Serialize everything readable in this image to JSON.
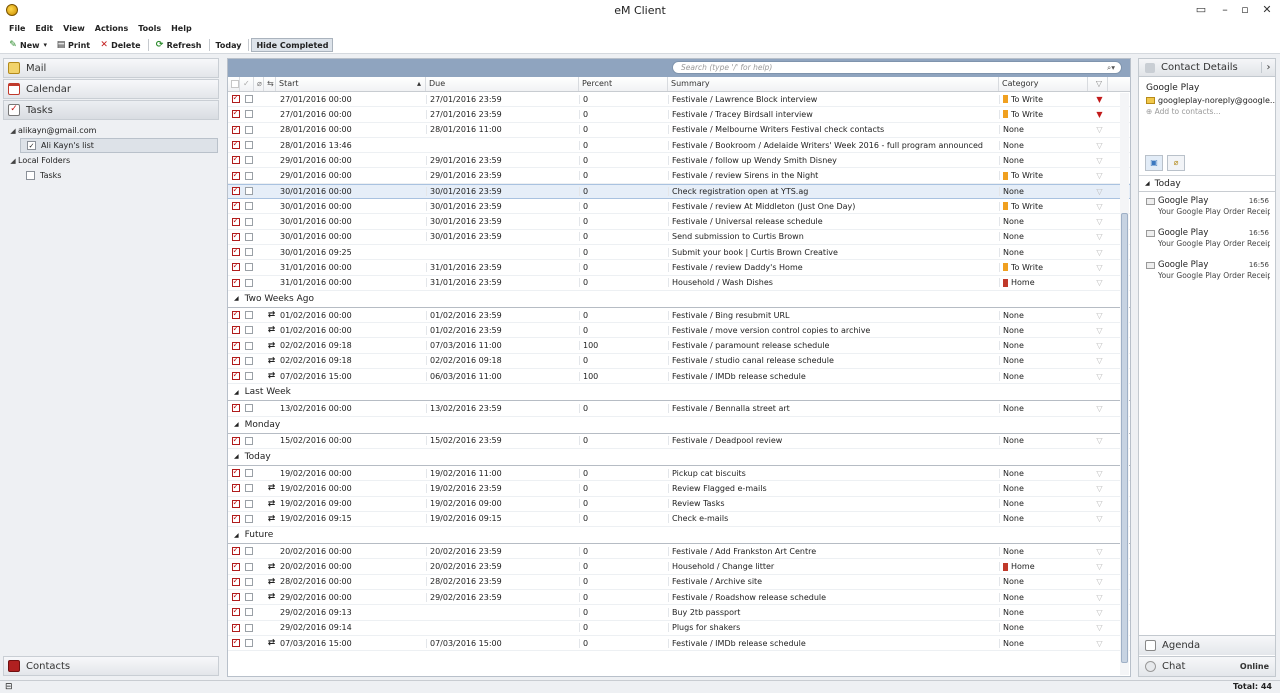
{
  "window": {
    "title": "eM Client"
  },
  "menu": [
    "File",
    "Edit",
    "View",
    "Actions",
    "Tools",
    "Help"
  ],
  "toolbar": {
    "new": "New",
    "print": "Print",
    "delete": "Delete",
    "refresh": "Refresh",
    "today": "Today",
    "hide_completed": "Hide Completed"
  },
  "nav": {
    "mail": "Mail",
    "calendar": "Calendar",
    "tasks": "Tasks",
    "contacts": "Contacts"
  },
  "folders": {
    "account": "alikayn@gmail.com",
    "list": "Ali Kayn's list",
    "local": "Local Folders",
    "tasks": "Tasks"
  },
  "search": {
    "placeholder": "Search (type '/' for help)"
  },
  "columns": {
    "start": "Start",
    "due": "Due",
    "percent": "Percent",
    "summary": "Summary",
    "category": "Category"
  },
  "colors": {
    "to_write": "#f0a020",
    "home": "#c0392b",
    "flag_red": "#c21a1a"
  },
  "groups": [
    {
      "label": "",
      "rows": [
        {
          "start": "27/01/2016 00:00",
          "due": "27/01/2016 23:59",
          "pct": "0",
          "summary": "Festivale / Lawrence Block interview",
          "cat": "To Write",
          "flag": true,
          "rec": false,
          "done": true
        },
        {
          "start": "27/01/2016 00:00",
          "due": "27/01/2016 23:59",
          "pct": "0",
          "summary": "Festivale / Tracey Birdsall interview",
          "cat": "To Write",
          "flag": true,
          "rec": false,
          "done": true
        },
        {
          "start": "28/01/2016 00:00",
          "due": "28/01/2016 11:00",
          "pct": "0",
          "summary": "Festivale / Melbourne Writers Festival check contacts",
          "cat": "None",
          "flag": false,
          "rec": false,
          "done": true
        },
        {
          "start": "28/01/2016 13:46",
          "due": "",
          "pct": "0",
          "summary": "Festivale / Bookroom / Adelaide Writers' Week 2016 - full program announced",
          "cat": "None",
          "flag": false,
          "rec": false,
          "done": true
        },
        {
          "start": "29/01/2016 00:00",
          "due": "29/01/2016 23:59",
          "pct": "0",
          "summary": "Festivale / follow up Wendy Smith Disney",
          "cat": "None",
          "flag": false,
          "rec": false,
          "done": true
        },
        {
          "start": "29/01/2016 00:00",
          "due": "29/01/2016 23:59",
          "pct": "0",
          "summary": "Festivale / review Sirens in the Night",
          "cat": "To Write",
          "flag": false,
          "rec": false,
          "done": true
        },
        {
          "start": "30/01/2016 00:00",
          "due": "30/01/2016 23:59",
          "pct": "0",
          "summary": "Check registration open at YTS.ag",
          "cat": "None",
          "flag": false,
          "rec": false,
          "done": true,
          "highlight": true
        },
        {
          "start": "30/01/2016 00:00",
          "due": "30/01/2016 23:59",
          "pct": "0",
          "summary": "Festivale / review At Middleton (Just One Day)",
          "cat": "To Write",
          "flag": false,
          "rec": false,
          "done": true
        },
        {
          "start": "30/01/2016 00:00",
          "due": "30/01/2016 23:59",
          "pct": "0",
          "summary": "Festivale / Universal release schedule",
          "cat": "None",
          "flag": false,
          "rec": false,
          "done": true
        },
        {
          "start": "30/01/2016 00:00",
          "due": "30/01/2016 23:59",
          "pct": "0",
          "summary": "Send submission to Curtis Brown",
          "cat": "None",
          "flag": false,
          "rec": false,
          "done": true
        },
        {
          "start": "30/01/2016 09:25",
          "due": "",
          "pct": "0",
          "summary": "Submit your book | Curtis Brown Creative",
          "cat": "None",
          "flag": false,
          "rec": false,
          "done": true
        },
        {
          "start": "31/01/2016 00:00",
          "due": "31/01/2016 23:59",
          "pct": "0",
          "summary": "Festivale / review Daddy's Home",
          "cat": "To Write",
          "flag": false,
          "rec": false,
          "done": true
        },
        {
          "start": "31/01/2016 00:00",
          "due": "31/01/2016 23:59",
          "pct": "0",
          "summary": "Household / Wash Dishes",
          "cat": "Home",
          "flag": false,
          "rec": false,
          "done": true
        }
      ]
    },
    {
      "label": "Two Weeks Ago",
      "rows": [
        {
          "start": "01/02/2016 00:00",
          "due": "01/02/2016 23:59",
          "pct": "0",
          "summary": "Festivale / Bing resubmit URL",
          "cat": "None",
          "flag": false,
          "rec": true,
          "done": true
        },
        {
          "start": "01/02/2016 00:00",
          "due": "01/02/2016 23:59",
          "pct": "0",
          "summary": "Festivale / move version control copies to archive",
          "cat": "None",
          "flag": false,
          "rec": true,
          "done": true
        },
        {
          "start": "02/02/2016 09:18",
          "due": "07/03/2016 11:00",
          "pct": "100",
          "summary": "Festivale / paramount release schedule",
          "cat": "None",
          "flag": false,
          "rec": true,
          "done": true
        },
        {
          "start": "02/02/2016 09:18",
          "due": "02/02/2016 09:18",
          "pct": "0",
          "summary": "Festivale /  studio canal release schedule",
          "cat": "None",
          "flag": false,
          "rec": true,
          "done": true
        },
        {
          "start": "07/02/2016 15:00",
          "due": "06/03/2016 11:00",
          "pct": "100",
          "summary": "Festivale / IMDb release schedule",
          "cat": "None",
          "flag": false,
          "rec": true,
          "done": true
        }
      ]
    },
    {
      "label": "Last Week",
      "rows": [
        {
          "start": "13/02/2016 00:00",
          "due": "13/02/2016 23:59",
          "pct": "0",
          "summary": "Festivale / Bennalla street art",
          "cat": "None",
          "flag": false,
          "rec": false,
          "done": true
        }
      ]
    },
    {
      "label": "Monday",
      "rows": [
        {
          "start": "15/02/2016 00:00",
          "due": "15/02/2016 23:59",
          "pct": "0",
          "summary": "Festivale / Deadpool review",
          "cat": "None",
          "flag": false,
          "rec": false,
          "done": true
        }
      ]
    },
    {
      "label": "Today",
      "rows": [
        {
          "start": "19/02/2016 00:00",
          "due": "19/02/2016 11:00",
          "pct": "0",
          "summary": "Pickup cat biscuits",
          "cat": "None",
          "flag": false,
          "rec": false,
          "done": true
        },
        {
          "start": "19/02/2016 00:00",
          "due": "19/02/2016 23:59",
          "pct": "0",
          "summary": "Review Flagged e-mails",
          "cat": "None",
          "flag": false,
          "rec": true,
          "done": true
        },
        {
          "start": "19/02/2016 09:00",
          "due": "19/02/2016 09:00",
          "pct": "0",
          "summary": "Review Tasks",
          "cat": "None",
          "flag": false,
          "rec": true,
          "done": true
        },
        {
          "start": "19/02/2016 09:15",
          "due": "19/02/2016 09:15",
          "pct": "0",
          "summary": "Check e-mails",
          "cat": "None",
          "flag": false,
          "rec": true,
          "done": true
        }
      ]
    },
    {
      "label": "Future",
      "rows": [
        {
          "start": "20/02/2016 00:00",
          "due": "20/02/2016 23:59",
          "pct": "0",
          "summary": "Festivale / Add Frankston Art Centre",
          "cat": "None",
          "flag": false,
          "rec": false,
          "done": true
        },
        {
          "start": "20/02/2016 00:00",
          "due": "20/02/2016 23:59",
          "pct": "0",
          "summary": "Household / Change litter",
          "cat": "Home",
          "flag": false,
          "rec": true,
          "done": true
        },
        {
          "start": "28/02/2016 00:00",
          "due": "28/02/2016 23:59",
          "pct": "0",
          "summary": "Festivale / Archive site",
          "cat": "None",
          "flag": false,
          "rec": true,
          "done": true
        },
        {
          "start": "29/02/2016 00:00",
          "due": "29/02/2016 23:59",
          "pct": "0",
          "summary": "Festivale / Roadshow release schedule",
          "cat": "None",
          "flag": false,
          "rec": true,
          "done": true
        },
        {
          "start": "29/02/2016 09:13",
          "due": "",
          "pct": "0",
          "summary": "Buy 2tb passport",
          "cat": "None",
          "flag": false,
          "rec": false,
          "done": true
        },
        {
          "start": "29/02/2016 09:14",
          "due": "",
          "pct": "0",
          "summary": "Plugs for shakers",
          "cat": "None",
          "flag": false,
          "rec": false,
          "done": true
        },
        {
          "start": "07/03/2016 15:00",
          "due": "07/03/2016 15:00",
          "pct": "0",
          "summary": "Festivale / IMDb release schedule",
          "cat": "None",
          "flag": false,
          "rec": true,
          "done": true
        }
      ]
    }
  ],
  "contact_details": {
    "header": "Contact Details",
    "name": "Google Play",
    "email": "googleplay-noreply@google....",
    "add": "Add to contacts...",
    "group": "Today",
    "mails": [
      {
        "from": "Google Play",
        "time": "16:56",
        "subject": "Your Google Play Order Receip..."
      },
      {
        "from": "Google Play",
        "time": "16:56",
        "subject": "Your Google Play Order Receip..."
      },
      {
        "from": "Google Play",
        "time": "16:56",
        "subject": "Your Google Play Order Receip..."
      }
    ]
  },
  "agenda": "Agenda",
  "chat": {
    "label": "Chat",
    "status": "Online"
  },
  "status": {
    "total": "Total: 44"
  }
}
